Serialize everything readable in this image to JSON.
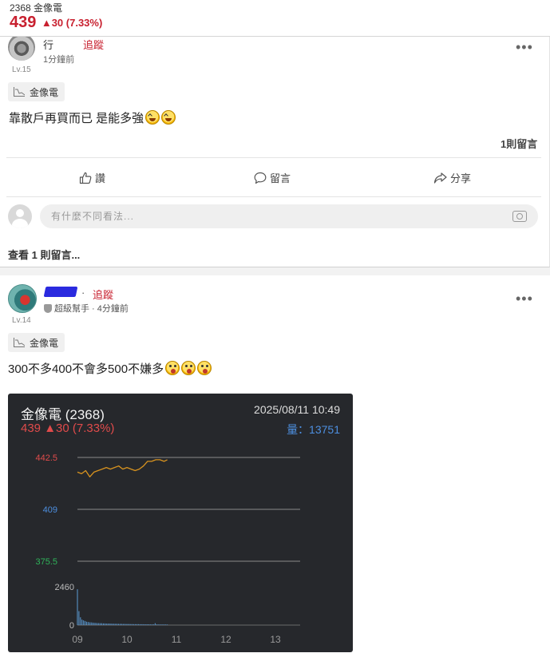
{
  "header": {
    "stock_code_name": "2368 金像電",
    "price": "439",
    "change": "▲30 (7.33%)",
    "price_color": "#c8202f"
  },
  "post1": {
    "author_name": "行",
    "follow": "追蹤",
    "time": "1分鐘前",
    "level": "Lv.15",
    "more": "•••",
    "tag": "金像電",
    "content": "靠散戶再買而已 是能多強",
    "content_emojis": [
      "grinning-squint-face",
      "grinning-squint-face"
    ],
    "reply_count": "1則留言",
    "actions": {
      "like": "讚",
      "comment": "留言",
      "share": "分享"
    },
    "comment_placeholder": "有什麼不同看法...",
    "view_comments": "查看 1 則留言..."
  },
  "post2": {
    "separator_follow": "· ",
    "follow": "追蹤",
    "badge": "超級幫手 · 4分鐘前",
    "level": "Lv.14",
    "more": "•••",
    "tag": "金像電",
    "content": "300不多400不會多500不嫌多",
    "content_emojis": [
      "zany-face",
      "zany-face",
      "zany-face"
    ],
    "card": {
      "name": "金像電 (2368)",
      "price_change": "439 ▲30 (7.33%)",
      "datetime": "2025/08/11 10:49",
      "volume": "量：13751",
      "background": "#26282c",
      "up_color": "#e04b4b",
      "volume_color": "#4d8fe0"
    }
  },
  "chart_data": {
    "type": "line",
    "title": "金像電 (2368)",
    "x_ticks": [
      "09",
      "10",
      "11",
      "12",
      "13"
    ],
    "y_ticks": [
      {
        "label": "442.5",
        "value": 442.5,
        "color": "#e04b4b"
      },
      {
        "label": "409",
        "value": 409,
        "color": "#4d8fe0"
      },
      {
        "label": "375.5",
        "value": 375.5,
        "color": "#2fb35a"
      }
    ],
    "ylim": [
      375.5,
      442.5
    ],
    "series": [
      {
        "name": "price",
        "color": "#d8931f",
        "x": [
          "09:00",
          "09:05",
          "09:10",
          "09:15",
          "09:20",
          "09:25",
          "09:30",
          "09:35",
          "09:40",
          "09:45",
          "09:50",
          "09:55",
          "10:00",
          "10:05",
          "10:10",
          "10:15",
          "10:20",
          "10:25",
          "10:30",
          "10:35",
          "10:40",
          "10:45",
          "10:49"
        ],
        "y": [
          433,
          432,
          434,
          430,
          433,
          434,
          435,
          436,
          435,
          436,
          437,
          435,
          436,
          435,
          434,
          435,
          437,
          440,
          440,
          441,
          441,
          440,
          441
        ]
      }
    ],
    "volume": {
      "ymax_label": "2460",
      "ymin_label": "0",
      "ymax": 2460,
      "color": "#5b9bd5",
      "values": [
        2300,
        900,
        500,
        350,
        300,
        260,
        220,
        200,
        180,
        170,
        160,
        150,
        140,
        130,
        130,
        120,
        120,
        110,
        110,
        100,
        100,
        100,
        95,
        90,
        90,
        85,
        85,
        80,
        80,
        80,
        75,
        75,
        70,
        70,
        70,
        65,
        65,
        60,
        60,
        60,
        60,
        55,
        55,
        55,
        50,
        50,
        50,
        50,
        45,
        45,
        45,
        120,
        45,
        40,
        40,
        40,
        40,
        40,
        40,
        35
      ]
    },
    "grid": true
  }
}
